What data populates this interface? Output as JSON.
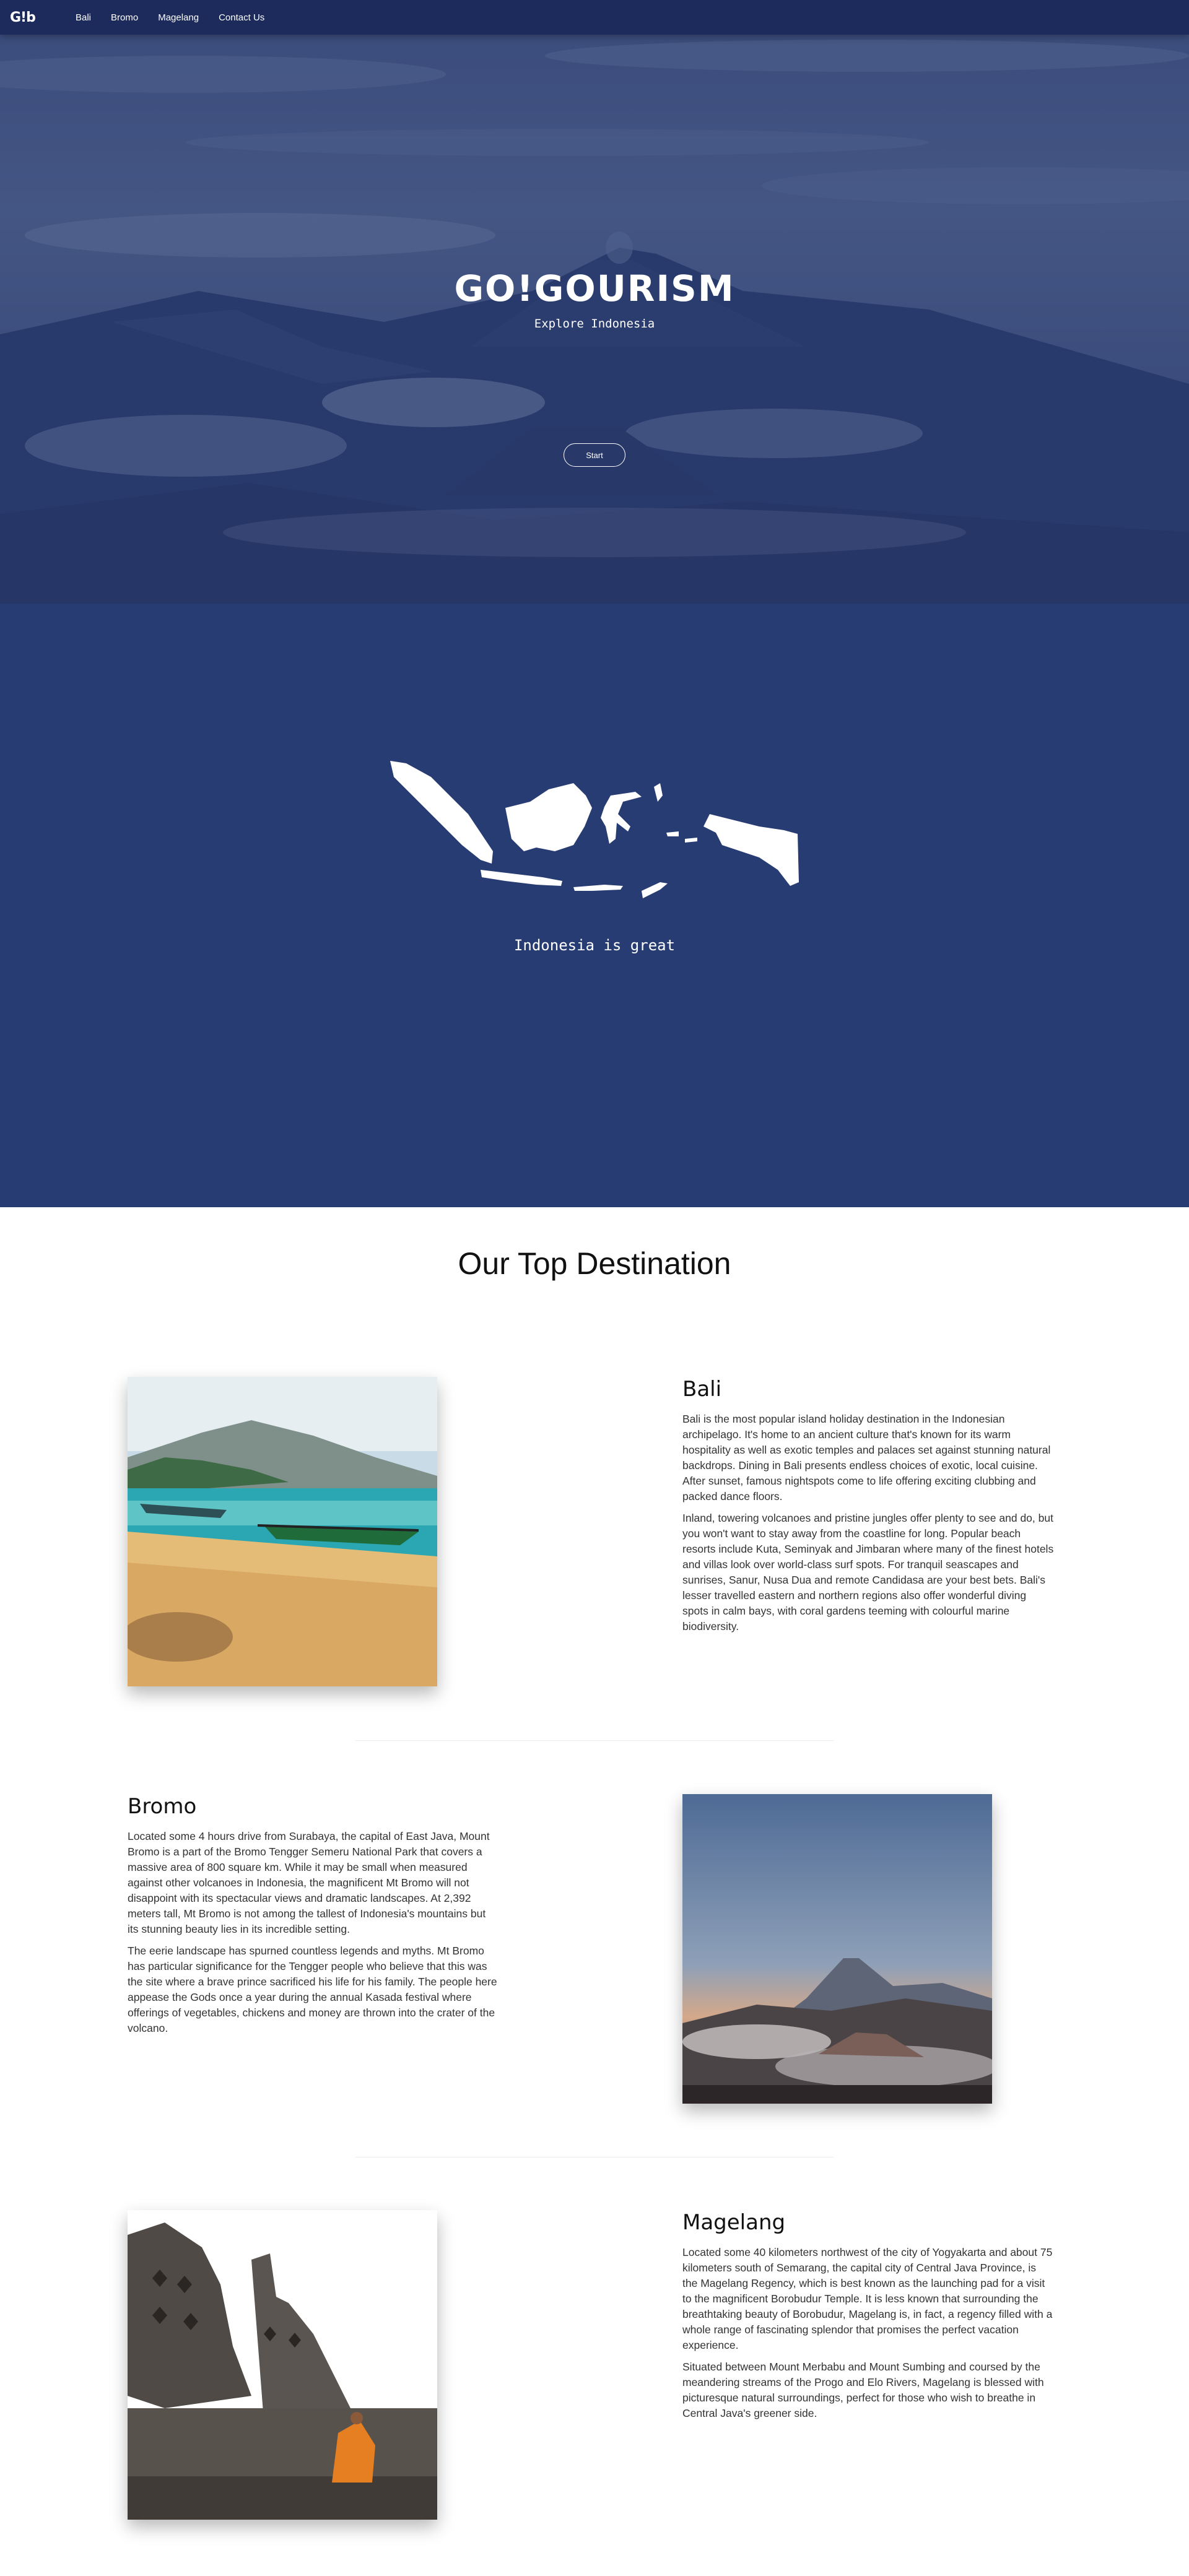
{
  "nav": {
    "logo": "G!b",
    "items": [
      "Bali",
      "Bromo",
      "Magelang",
      "Contact Us"
    ]
  },
  "hero": {
    "brand": "GO!GOURISM",
    "tagline": "Explore Indonesia",
    "start_label": "Start"
  },
  "map": {
    "caption": "Indonesia is great"
  },
  "destinations": {
    "title": "Our Top Destination",
    "items": [
      {
        "name": "Bali",
        "paragraphs": [
          "Bali is the most popular island holiday destination in the Indonesian archipelago. It's home to an ancient culture that's known for its warm hospitality as well as exotic temples and palaces set against stunning natural backdrops. Dining in Bali presents endless choices of exotic, local cuisine. After sunset, famous nightspots come to life offering exciting clubbing and packed dance floors.",
          "Inland, towering volcanoes and pristine jungles offer plenty to see and do, but you won't want to stay away from the coastline for long. Popular beach resorts include Kuta, Seminyak and Jimbaran where many of the finest hotels and villas look over world-class surf spots. For tranquil seascapes and sunrises, Sanur, Nusa Dua and remote Candidasa are your best bets. Bali's lesser travelled eastern and northern regions also offer wonderful diving spots in calm bays, with coral gardens teeming with colourful marine biodiversity."
        ]
      },
      {
        "name": "Bromo",
        "paragraphs": [
          "Located some 4 hours drive from Surabaya, the capital of East Java, Mount Bromo is a part of the Bromo Tengger Semeru National Park that covers a massive area of 800 square km. While it may be small when measured against other volcanoes in Indonesia, the magnificent Mt Bromo will not disappoint with its spectacular views and dramatic landscapes. At 2,392 meters tall, Mt Bromo is not among the tallest of Indonesia's mountains but its stunning beauty lies in its incredible setting.",
          "The eerie landscape has spurned countless legends and myths. Mt Bromo has particular significance for the Tengger people who believe that this was the site where a brave prince sacrificed his life for his family. The people here appease the Gods once a year during the annual Kasada festival where offerings of vegetables, chickens and money are thrown into the crater of the volcano."
        ]
      },
      {
        "name": "Magelang",
        "paragraphs": [
          "Located some 40 kilometers northwest of the city of Yogyakarta and about 75 kilometers south of Semarang, the capital city of Central Java Province, is the Magelang Regency, which is best known as the launching pad for a visit to the magnificent Borobudur Temple. It is less known that surrounding the breathtaking beauty of Borobudur, Magelang is, in fact, a regency filled with a whole range of fascinating splendor that promises the perfect vacation experience.",
          "Situated between Mount Merbabu and Mount Sumbing and coursed by the meandering streams of the Progo and Elo Rivers, Magelang is blessed with picturesque natural surroundings, perfect for those who wish to breathe in Central Java's greener side."
        ]
      }
    ]
  },
  "colors": {
    "nav": "#1c2b5c",
    "map_section": "#283c74",
    "text": "#333333"
  }
}
